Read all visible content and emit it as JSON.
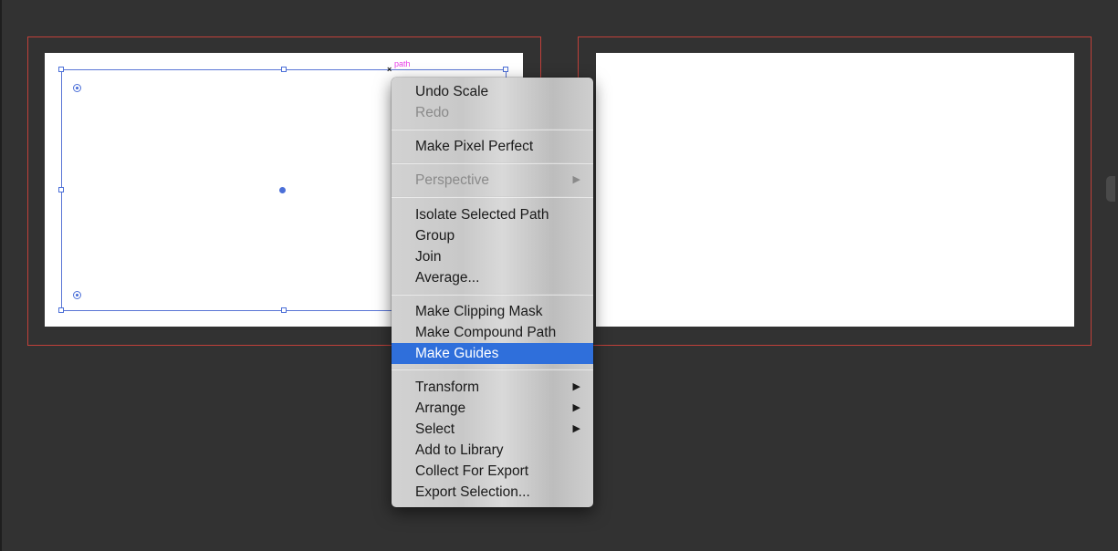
{
  "canvas": {
    "smart_guide_label": "path",
    "cursor_glyph": "×"
  },
  "context_menu": {
    "items": [
      {
        "label": "Undo Scale",
        "enabled": true
      },
      {
        "label": "Redo",
        "enabled": false
      },
      {
        "label": "Make Pixel Perfect",
        "enabled": true
      },
      {
        "label": "Perspective",
        "enabled": false,
        "submenu": true
      },
      {
        "label": "Isolate Selected Path",
        "enabled": true
      },
      {
        "label": "Group",
        "enabled": true
      },
      {
        "label": "Join",
        "enabled": true
      },
      {
        "label": "Average...",
        "enabled": true
      },
      {
        "label": "Make Clipping Mask",
        "enabled": true
      },
      {
        "label": "Make Compound Path",
        "enabled": true
      },
      {
        "label": "Make Guides",
        "enabled": true,
        "highlighted": true
      },
      {
        "label": "Transform",
        "enabled": true,
        "submenu": true
      },
      {
        "label": "Arrange",
        "enabled": true,
        "submenu": true
      },
      {
        "label": "Select",
        "enabled": true,
        "submenu": true
      },
      {
        "label": "Add to Library",
        "enabled": true
      },
      {
        "label": "Collect For Export",
        "enabled": true
      },
      {
        "label": "Export Selection...",
        "enabled": true
      }
    ],
    "submenu_arrow": "▶"
  },
  "colors": {
    "canvas_bg": "#323232",
    "bleed_outline": "#c0403a",
    "selection": "#4b6fd8",
    "highlight": "#2f6fdb",
    "smart_guide": "#e83ee8"
  }
}
